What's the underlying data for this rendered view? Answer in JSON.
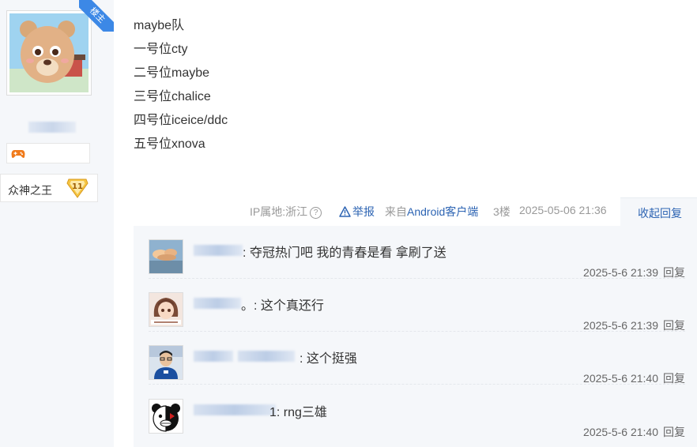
{
  "user": {
    "owner_ribbon": "楼主",
    "title": "众神之王",
    "level": "11"
  },
  "post": {
    "lines": [
      "maybe队",
      "一号位cty",
      "二号位maybe",
      "三号位chalice",
      "四号位iceice/ddc",
      "五号位xnova"
    ]
  },
  "meta": {
    "ip": "IP属地:浙江",
    "report": "举报",
    "from_prefix": "来自",
    "client": "Android客户端",
    "floor": "3楼",
    "time": "2025-05-06 21:36",
    "collapse": "收起回复"
  },
  "replies": [
    {
      "text": ": 夺冠热门吧 我的青春是看 拿刷了送",
      "time": "2025-5-6 21:39",
      "reply": "回复"
    },
    {
      "text": "。: 这个真还行",
      "time": "2025-5-6 21:39",
      "reply": "回复"
    },
    {
      "text": ": 这个挺强",
      "time": "2025-5-6 21:40",
      "reply": "回复"
    },
    {
      "text": "1: rng三雄",
      "time": "2025-5-6 21:40",
      "reply": "回复"
    }
  ],
  "colors": {
    "link": "#2d64b3",
    "ribbon": "#3c88e6",
    "reply_bg": "#f5f7fa"
  },
  "icons": [
    "question-icon",
    "warning-icon",
    "gamepad-icon",
    "level-badge-icon"
  ]
}
